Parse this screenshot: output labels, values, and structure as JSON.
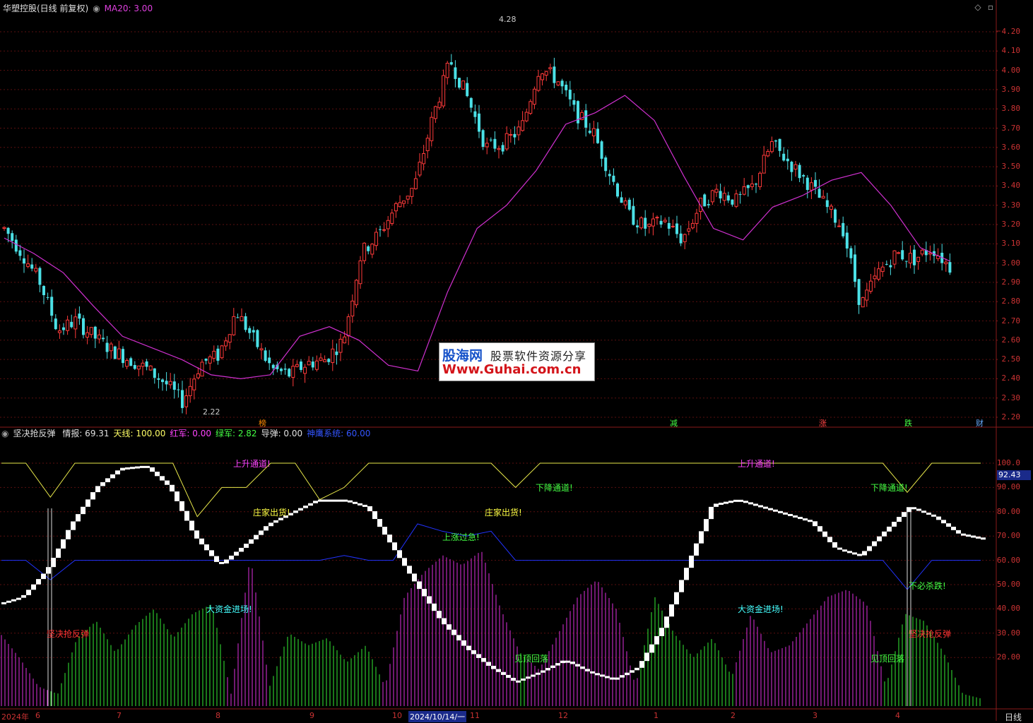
{
  "header": {
    "stock_title": "华塑控股(日线 前复权)",
    "ma_label": "MA20: 3.00",
    "colors": {
      "title": "#e0e0e0",
      "ma": "#e040e0"
    }
  },
  "indicator_header": {
    "name": "坚决抢反弹",
    "items": [
      {
        "text": "情报: 69.31",
        "color": "#e0e0e0"
      },
      {
        "text": "天线: 100.00",
        "color": "#ffff66"
      },
      {
        "text": "红军: 0.00",
        "color": "#ff44ff"
      },
      {
        "text": "绿军: 2.82",
        "color": "#44ff44"
      },
      {
        "text": "导弹: 0.00",
        "color": "#e0e0e0"
      },
      {
        "text": "神鹰系统: 60.00",
        "color": "#3355ff"
      }
    ]
  },
  "price_axis": [
    "4.20",
    "4.10",
    "4.00",
    "3.90",
    "3.80",
    "3.70",
    "3.60",
    "3.50",
    "3.40",
    "3.30",
    "3.20",
    "3.10",
    "3.00",
    "2.90",
    "2.80",
    "2.70",
    "2.60",
    "2.50",
    "2.40",
    "2.30",
    "2.20"
  ],
  "ind_axis": [
    "100.0",
    "90.00",
    "80.00",
    "70.00",
    "60.00",
    "50.00",
    "40.00",
    "30.00",
    "20.00"
  ],
  "ind_current": "92.43",
  "price_marks": {
    "high": "4.28",
    "low": "2.22"
  },
  "events": [
    {
      "text": "榜",
      "color": "#ff8800"
    },
    {
      "text": "减",
      "color": "#44ff44"
    },
    {
      "text": "涨",
      "color": "#ff4444"
    },
    {
      "text": "跌",
      "color": "#44ff44"
    },
    {
      "text": "财",
      "color": "#66aaff"
    }
  ],
  "dates": [
    "2024年",
    "6",
    "7",
    "8",
    "9",
    "10",
    "2024/10/14/一",
    "11",
    "12",
    "1",
    "2",
    "3",
    "4"
  ],
  "period_label": "日线",
  "signals": [
    {
      "text": "上升通道!",
      "color": "#ff44ff"
    },
    {
      "text": "庄家出货!",
      "color": "#ffff44"
    },
    {
      "text": "大资金进场!",
      "color": "#44ffff"
    },
    {
      "text": "坚决抢反弹",
      "color": "#ff3333"
    },
    {
      "text": "下降通道!",
      "color": "#44ff44"
    },
    {
      "text": "庄家出货!",
      "color": "#ffff44"
    },
    {
      "text": "上涨过急!",
      "color": "#44ff44"
    },
    {
      "text": "见顶回落",
      "color": "#44ff44"
    },
    {
      "text": "上升通道!",
      "color": "#ff44ff"
    },
    {
      "text": "大资金进场!",
      "color": "#44ffff"
    },
    {
      "text": "下降通道!",
      "color": "#44ff44"
    },
    {
      "text": "不必杀跌!",
      "color": "#44ff44"
    },
    {
      "text": "坚决抢反弹",
      "color": "#ff3333"
    },
    {
      "text": "见顶回落",
      "color": "#44ff44"
    }
  ],
  "watermark": {
    "brand": "股海网",
    "slogan": "股票软件资源分享",
    "url": "Www.Guhai.com.cn"
  },
  "chart_data": {
    "type": "line",
    "title": "华塑控股(日线 前复权)",
    "series": [
      {
        "name": "MA20",
        "values": [
          3.13,
          3.05,
          2.95,
          2.78,
          2.62,
          2.56,
          2.5,
          2.42,
          2.4,
          2.42,
          2.62,
          2.67,
          2.6,
          2.47,
          2.44,
          2.85,
          3.18,
          3.3,
          3.48,
          3.72,
          3.78,
          3.87,
          3.74,
          3.45,
          3.18,
          3.12,
          3.29,
          3.35,
          3.43,
          3.47,
          3.3,
          3.08,
          3.01
        ]
      },
      {
        "name": "情报",
        "values": [
          42,
          45,
          56,
          75,
          90,
          98,
          99,
          90,
          70,
          58,
          66,
          75,
          80,
          85,
          85,
          82,
          66,
          50,
          35,
          24,
          16,
          10,
          14,
          19,
          14,
          11,
          16,
          33,
          58,
          83,
          85,
          82,
          79,
          76,
          65,
          62,
          72,
          82,
          78,
          71,
          69
        ]
      },
      {
        "name": "天线",
        "values": [
          100,
          100,
          86,
          100,
          100,
          100,
          100,
          100,
          78,
          90,
          90,
          100,
          100,
          85,
          90,
          100,
          100,
          100,
          100,
          100,
          100,
          90,
          100,
          100,
          100,
          100,
          100,
          100,
          100,
          100,
          100,
          100,
          100,
          100,
          100,
          100,
          100,
          88,
          100,
          100,
          100
        ]
      }
    ]
  }
}
